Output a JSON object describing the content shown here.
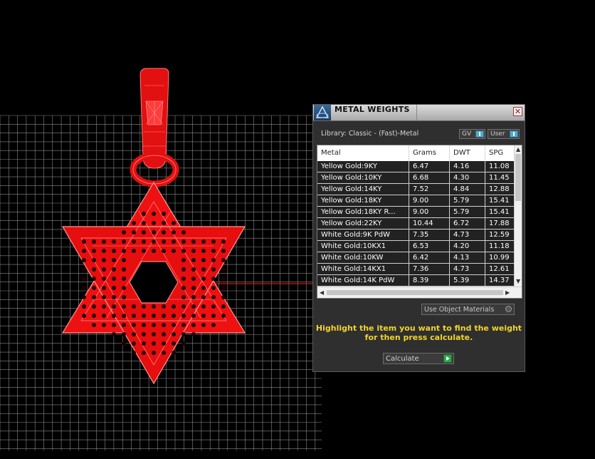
{
  "panel": {
    "title": "METAL WEIGHTS",
    "close_glyph": "✕",
    "library_label": "Library: Classic - (Fast)-Metal",
    "toggle_gv": "GV",
    "toggle_user": "User",
    "columns": [
      "Metal",
      "Grams",
      "DWT",
      "SPG"
    ],
    "rows": [
      [
        "Yellow Gold:9KY",
        "6.47",
        "4.16",
        "11.08"
      ],
      [
        "Yellow Gold:10KY",
        "6.68",
        "4.30",
        "11.45"
      ],
      [
        "Yellow Gold:14KY",
        "7.52",
        "4.84",
        "12.88"
      ],
      [
        "Yellow Gold:18KY",
        "9.00",
        "5.79",
        "15.41"
      ],
      [
        "Yellow Gold:18KY R...",
        "9.00",
        "5.79",
        "15.41"
      ],
      [
        "Yellow Gold:22KY",
        "10.44",
        "6.72",
        "17.88"
      ],
      [
        "White Gold:9K PdW",
        "7.35",
        "4.73",
        "12.59"
      ],
      [
        "White Gold:10KX1",
        "6.53",
        "4.20",
        "11.18"
      ],
      [
        "White Gold:10KW",
        "6.42",
        "4.13",
        "10.99"
      ],
      [
        "White Gold:14KX1",
        "7.36",
        "4.73",
        "12.61"
      ],
      [
        "White Gold:14K PdW",
        "8.39",
        "5.39",
        "14.37"
      ]
    ],
    "use_object_materials": "Use Object Materials",
    "instruction_line1": "Highlight the item you want to find the weight",
    "instruction_line2": "for then press calculate.",
    "calculate_label": "Calculate"
  },
  "colors": {
    "model": "#ff1a1a",
    "grid": "#8a8a8a",
    "instruction": "#f2d42a",
    "panel_bg": "#2f2f2f"
  },
  "icons": {
    "logo": "app-logo-icon",
    "close": "close-icon",
    "toggle": "toggle-switch-icon",
    "play": "play-icon"
  }
}
